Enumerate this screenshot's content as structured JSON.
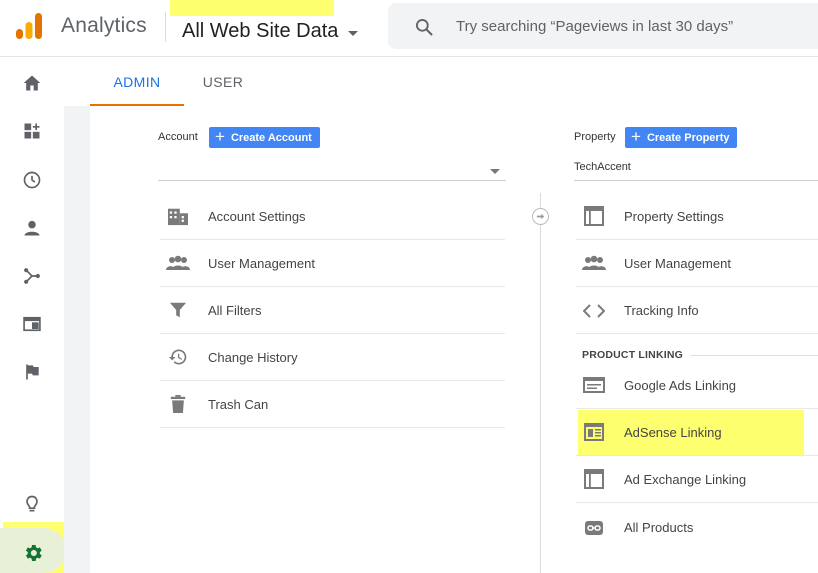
{
  "header": {
    "app_name": "Analytics",
    "view_name": "All Web Site Data",
    "search_placeholder": "Try searching “Pageviews in last 30 days”"
  },
  "tabs": [
    {
      "label": "ADMIN",
      "active": true
    },
    {
      "label": "USER",
      "active": false
    }
  ],
  "account": {
    "label": "Account",
    "create_button": "Create Account",
    "selected": "",
    "items": [
      {
        "label": "Account Settings",
        "icon": "building-icon"
      },
      {
        "label": "User Management",
        "icon": "people-icon"
      },
      {
        "label": "All Filters",
        "icon": "filter-icon"
      },
      {
        "label": "Change History",
        "icon": "history-icon"
      },
      {
        "label": "Trash Can",
        "icon": "trash-icon"
      }
    ]
  },
  "property": {
    "label": "Property",
    "create_button": "Create Property",
    "selected": "TechAccent",
    "items": [
      {
        "label": "Property Settings",
        "icon": "layout-icon"
      },
      {
        "label": "User Management",
        "icon": "people-icon"
      },
      {
        "label": "Tracking Info",
        "icon": "code-icon"
      }
    ],
    "section_title": "PRODUCT LINKING",
    "linking_items": [
      {
        "label": "Google Ads Linking",
        "icon": "ads-icon"
      },
      {
        "label": "AdSense Linking",
        "icon": "adsense-icon"
      },
      {
        "label": "Ad Exchange Linking",
        "icon": "adexchange-icon"
      },
      {
        "label": "All Products",
        "icon": "link-icon"
      }
    ]
  },
  "colors": {
    "accent_blue": "#1a73e8",
    "button_blue": "#4285f4",
    "tab_underline": "#e37400",
    "highlight": "#fdff6e"
  }
}
